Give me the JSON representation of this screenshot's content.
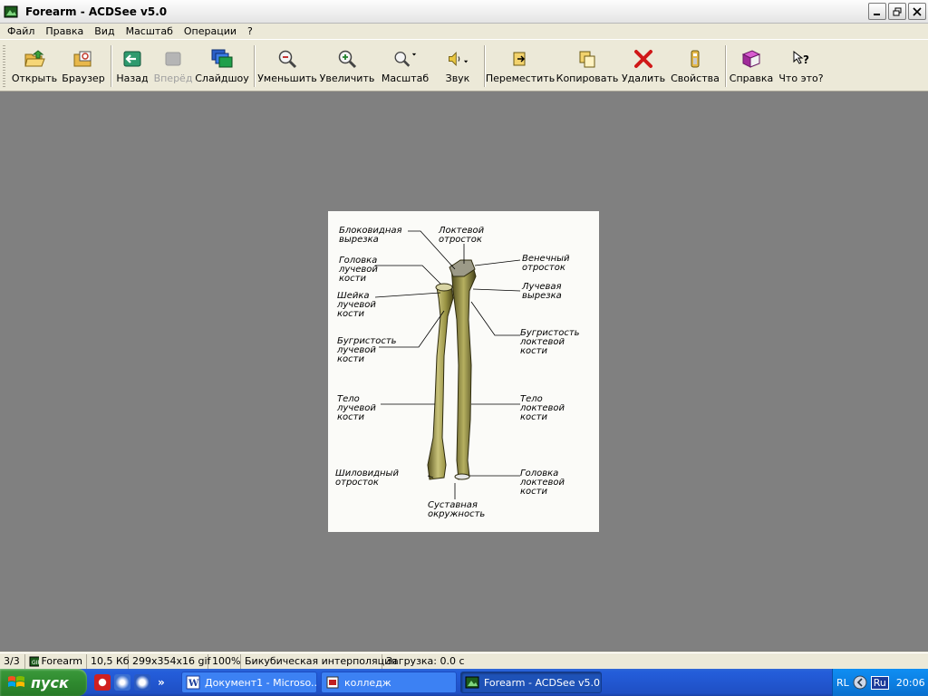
{
  "window": {
    "title": "Forearm - ACDSee v5.0",
    "icon": "acdsee-app-icon",
    "buttons": [
      "minimize",
      "restore",
      "close"
    ]
  },
  "menu": [
    "Файл",
    "Правка",
    "Вид",
    "Масштаб",
    "Операции",
    "?"
  ],
  "toolbar": {
    "open": "Открыть",
    "browser": "Браузер",
    "back": "Назад",
    "forward": "Вперёд",
    "slideshow": "Слайдшоу",
    "zoom_out": "Уменьшить",
    "zoom_in": "Увеличить",
    "zoom": "Масштаб",
    "sound": "Звук",
    "move": "Переместить",
    "copy": "Копировать",
    "delete": "Удалить",
    "properties": "Свойства",
    "help": "Справка",
    "whats_this": "Что это?"
  },
  "figure": {
    "labels": {
      "trochlear_notch": [
        "Блоковидная",
        "вырезка"
      ],
      "olecranon": [
        "Локтевой",
        "отросток"
      ],
      "radial_head": [
        "Головка",
        "лучевой",
        "кости"
      ],
      "coronoid": [
        "Венечный",
        "отросток"
      ],
      "radial_neck": [
        "Шейка",
        "лучевой",
        "кости"
      ],
      "radial_notch": [
        "Лучевая",
        "вырезка"
      ],
      "radial_tuberosity": [
        "Бугристость",
        "лучевой",
        "кости"
      ],
      "ulnar_tuberosity": [
        "Бугристость",
        "локтевой",
        "кости"
      ],
      "radius_body": [
        "Тело",
        "лучевой",
        "кости"
      ],
      "ulna_body": [
        "Тело",
        "локтевой",
        "кости"
      ],
      "styloid": [
        "Шиловидный",
        "отросток"
      ],
      "ulna_head": [
        "Головка",
        "локтевой",
        "кости"
      ],
      "articular_circumference": [
        "Суставная",
        "окружность"
      ]
    }
  },
  "status": {
    "index": "3/3",
    "name": "Forearm",
    "size": "10,5 Кб",
    "dims": "299x354x16 gif",
    "zoom": "100%",
    "interp": "Бикубическая интерполяция",
    "load": "Загрузка: 0.0 с"
  },
  "taskbar": {
    "start": "пуск",
    "tasks": [
      "Документ1 - Microso...",
      "колледж",
      "Forearm - ACDSee v5.0"
    ],
    "tray_lang": "RL",
    "tray_kbd": "Ru",
    "clock": "20:06"
  }
}
